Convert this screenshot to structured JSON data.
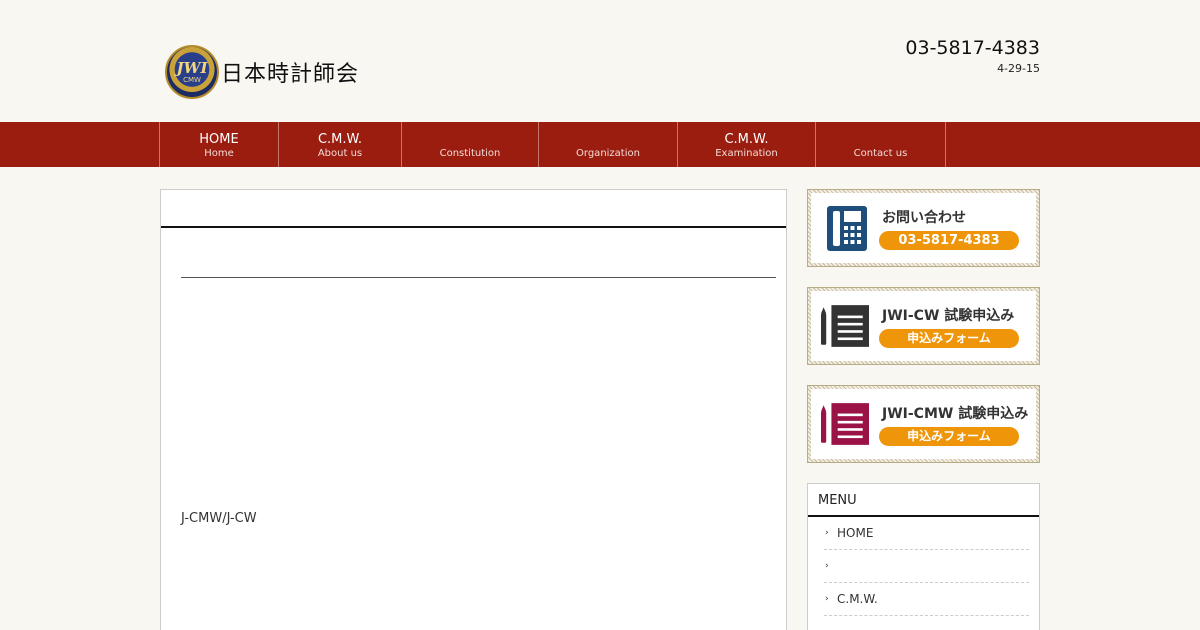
{
  "header": {
    "logo_text": "日本時計師会",
    "seal_main": "JWI",
    "seal_sub": "CMW",
    "phone": "03-5817-4383",
    "address": "4-29-15"
  },
  "nav": [
    {
      "label": "HOME",
      "sub": "Home"
    },
    {
      "label": "C.M.W.",
      "sub": "About us"
    },
    {
      "label": "",
      "sub": "Constitution"
    },
    {
      "label": "",
      "sub": "Organization"
    },
    {
      "label": "C.M.W.",
      "sub": "Examination"
    },
    {
      "label": "",
      "sub": "Contact us"
    }
  ],
  "content": {
    "body_text": "J-CMW/J-CW"
  },
  "banners": [
    {
      "title": "お問い合わせ",
      "pill": "03-5817-4383",
      "icon": "phone-icon"
    },
    {
      "title": "JWI-CW 試験申込み",
      "pill": "申込みフォーム",
      "icon": "document-icon"
    },
    {
      "title": "JWI-CMW 試験申込み",
      "pill": "申込みフォーム",
      "icon": "document-icon"
    }
  ],
  "menu": {
    "title": "MENU",
    "items": [
      "HOME",
      "",
      "C.M.W."
    ]
  },
  "colors": {
    "nav_bg": "#9a1d10",
    "pill": "#ef9509",
    "phone_icon": "#1f4e7a",
    "doc_icon_dark": "#333333",
    "doc_icon_red": "#9b1346"
  }
}
